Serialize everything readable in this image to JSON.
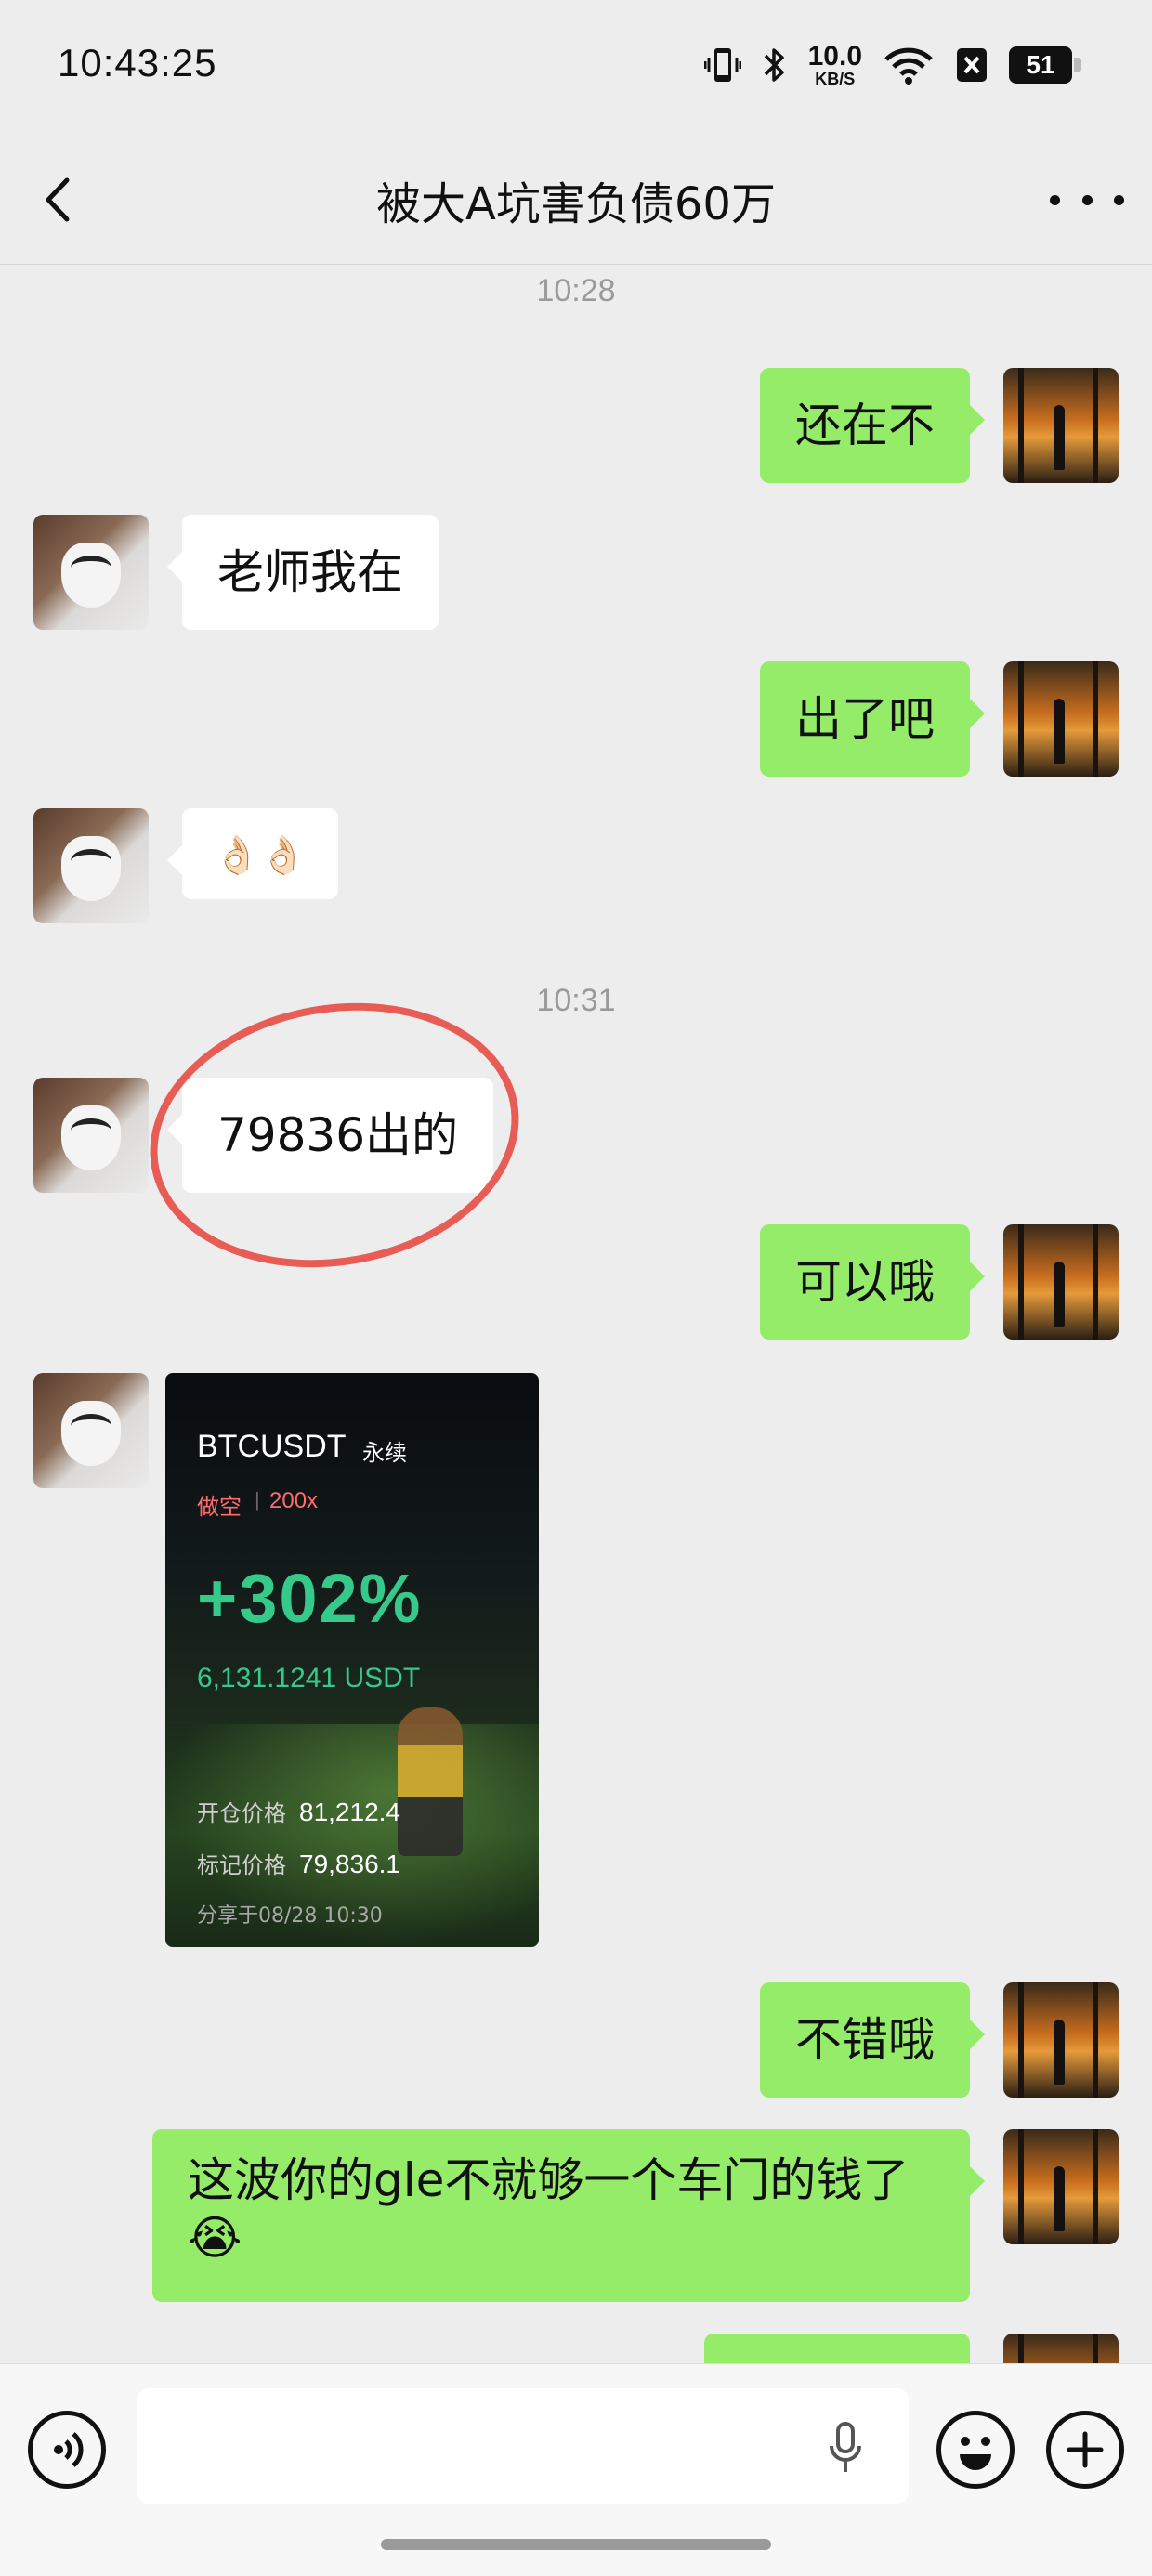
{
  "status_bar": {
    "time": "10:43:25",
    "net_speed_value": "10.0",
    "net_speed_unit": "KB/S",
    "battery_level": "51",
    "icons": [
      "vibrate-icon",
      "bluetooth-icon",
      "wifi-icon",
      "sim-off-icon",
      "battery-icon"
    ]
  },
  "nav": {
    "title": "被大A坑害负债60万",
    "back_icon": "chevron-left-icon",
    "more_icon": "more-dots-icon"
  },
  "messages": [
    {
      "type": "timestamp",
      "text": "10:28"
    },
    {
      "type": "text",
      "side": "out",
      "text": "还在不"
    },
    {
      "type": "text",
      "side": "in",
      "text": "老师我在"
    },
    {
      "type": "text",
      "side": "out",
      "text": "出了吧"
    },
    {
      "type": "text",
      "side": "in",
      "text": "👌🏻👌🏻"
    },
    {
      "type": "timestamp",
      "text": "10:31"
    },
    {
      "type": "text",
      "side": "in",
      "text": "79836出的",
      "annotated": "red-circle"
    },
    {
      "type": "text",
      "side": "out",
      "text": "可以哦"
    },
    {
      "type": "image",
      "side": "in"
    },
    {
      "type": "text",
      "side": "out",
      "text": "不错哦"
    },
    {
      "type": "text",
      "side": "out",
      "text": "这波你的gle不就够一个车门的钱了😭"
    }
  ],
  "trade_card": {
    "pair": "BTCUSDT",
    "contract": "永续",
    "side": "做空",
    "separator": "|",
    "leverage": "200x",
    "pnl_percent": "+302%",
    "pnl_amount": "6,131.1241 USDT",
    "open_label": "开仓价格",
    "open_price": "81,212.4",
    "mark_label": "标记价格",
    "mark_price": "79,836.1",
    "shared_at": "分享于08/28 10:30"
  },
  "input_bar": {
    "placeholder": "",
    "icons": [
      "voice-icon",
      "mic-icon",
      "emoji-icon",
      "plus-icon"
    ]
  },
  "colors": {
    "background": "#ededed",
    "bubble_out": "#95ec69",
    "bubble_in": "#ffffff",
    "pnl_green": "#35c98a",
    "short_red": "#ff6a6a",
    "annotation_red": "#e64c45"
  }
}
